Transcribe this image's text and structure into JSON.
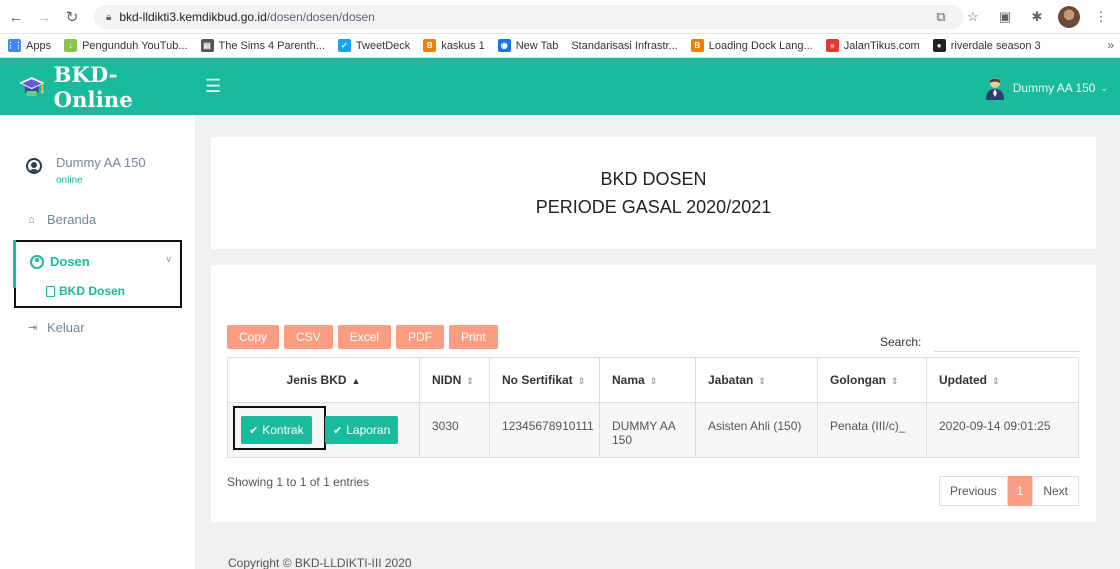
{
  "browser": {
    "url_domain": "bkd-lldikti3.kemdikbud.go.id",
    "url_path": "/dosen/dosen/dosen",
    "bookmarks": [
      {
        "label": "Apps",
        "icon": "apps-grid-icon",
        "color": "#4285f4"
      },
      {
        "label": "Pengunduh YouTub...",
        "icon": "download-leaf-icon",
        "color": "#8bc34a"
      },
      {
        "label": "The Sims 4 Parenth...",
        "icon": "sims-icon",
        "color": "#555555"
      },
      {
        "label": "TweetDeck",
        "icon": "tweetdeck-icon",
        "color": "#1da1f2"
      },
      {
        "label": "kaskus 1",
        "icon": "blogger-icon",
        "color": "#f57d00"
      },
      {
        "label": "New Tab",
        "icon": "newtab-icon",
        "color": "#1a73e8"
      },
      {
        "label": "Standarisasi Infrastr...",
        "icon": "",
        "color": ""
      },
      {
        "label": "Loading Dock Lang...",
        "icon": "blogger-icon",
        "color": "#f57d00"
      },
      {
        "label": "JalanTikus.com",
        "icon": "jalantikus-icon",
        "color": "#e53935"
      },
      {
        "label": "riverdale season 3",
        "icon": "riverdale-icon",
        "color": "#222222"
      }
    ]
  },
  "header": {
    "brand": "BKD-Online",
    "user_name": "Dummy AA 150"
  },
  "sidebar": {
    "profile_name": "Dummy AA 150",
    "profile_status": "online",
    "items": [
      {
        "label": "Beranda",
        "icon": "home-icon"
      },
      {
        "label": "Dosen",
        "icon": "user-circle-icon"
      },
      {
        "label": "BKD Dosen",
        "icon": "file-icon"
      },
      {
        "label": "Keluar",
        "icon": "sign-out-icon"
      }
    ]
  },
  "title": {
    "line1": "BKD DOSEN",
    "line2": "PERIODE GASAL 2020/2021"
  },
  "table": {
    "buttons": [
      "Copy",
      "CSV",
      "Excel",
      "PDF",
      "Print"
    ],
    "search_label": "Search:",
    "search_value": "",
    "columns": [
      "Jenis BKD",
      "NIDN",
      "No Sertifikat",
      "Nama",
      "Jabatan",
      "Golongan",
      "Updated"
    ],
    "sorted_column": "Jenis BKD",
    "rows": [
      {
        "actions": [
          "Kontrak",
          "Laporan"
        ],
        "nidn": "3030",
        "no_sertifikat": "12345678910111",
        "nama": "DUMMY AA 150",
        "jabatan": "Asisten Ahli (150)",
        "golongan": "Penata (III/c)_",
        "updated": "2020-09-14 09:01:25"
      }
    ],
    "showing": "Showing 1 to 1 of 1 entries",
    "pager": {
      "previous": "Previous",
      "current": "1",
      "next": "Next"
    }
  },
  "footer": "Copyright © BKD-LLDIKTI-III 2020",
  "colors": {
    "accent": "#1abb9c",
    "button_salmon": "#fa9d82",
    "sidebar_text": "#73879c"
  }
}
